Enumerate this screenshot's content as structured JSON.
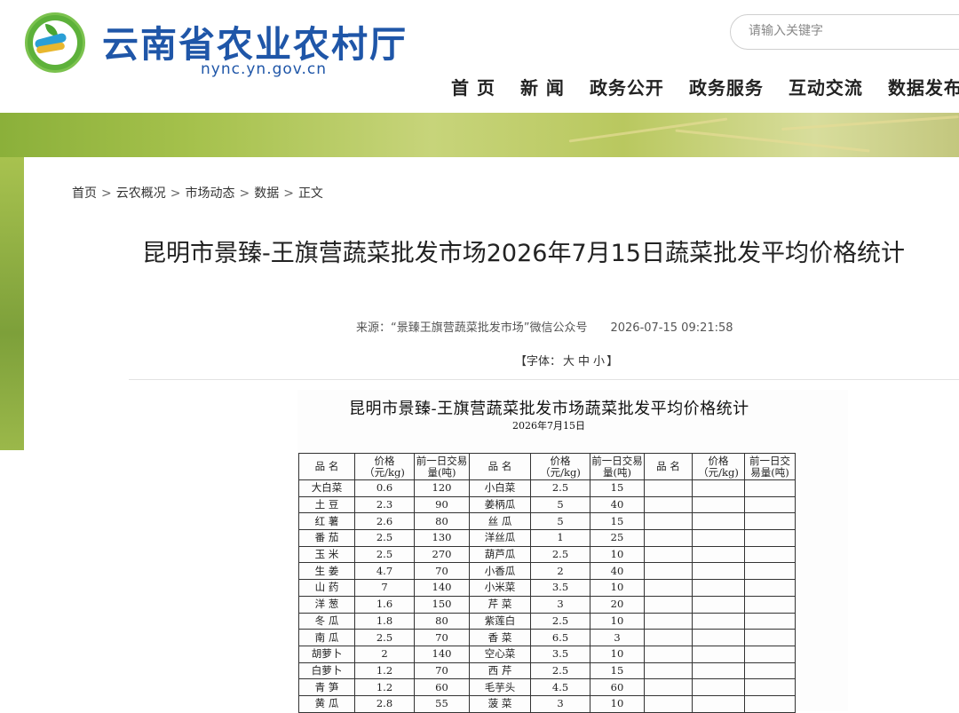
{
  "header": {
    "site_title": "云南省农业农村厅",
    "site_domain": "nync.yn.gov.cn",
    "search_placeholder": "请输入关键字"
  },
  "nav": [
    "首 页",
    "新 闻",
    "政务公开",
    "政务服务",
    "互动交流",
    "数据发布"
  ],
  "breadcrumb": [
    "首页",
    "云农概况",
    "市场动态",
    "数据",
    "正文"
  ],
  "breadcrumb_separator": ">",
  "article": {
    "title": "昆明市景臻-王旗营蔬菜批发市场2026年7月15日蔬菜批发平均价格统计",
    "source": "来源：“景臻王旗营蔬菜批发市场”微信公众号",
    "date": "2026-07-15 09:21:58",
    "font_prefix": "【字体：",
    "font_large": "大",
    "font_medium": "中",
    "font_small": "小",
    "font_suffix": "】"
  },
  "table": {
    "title": "昆明市景臻-王旗营蔬菜批发市场蔬菜批发平均价格统计",
    "date": "2026年7月15日",
    "headers": [
      "品  名",
      "价格（元/kg)",
      "前一日交易量(吨)",
      "品  名",
      "价格（元/kg)",
      "前一日交易量(吨)",
      "品  名",
      "价格（元/kg)",
      "前一日交易量(吨)"
    ],
    "rows": [
      [
        "大白菜",
        "0.6",
        "120",
        "小白菜",
        "2.5",
        "15",
        "",
        "",
        ""
      ],
      [
        "土  豆",
        "2.3",
        "90",
        "姜柄瓜",
        "5",
        "40",
        "",
        "",
        ""
      ],
      [
        "红  薯",
        "2.6",
        "80",
        "丝  瓜",
        "5",
        "15",
        "",
        "",
        ""
      ],
      [
        "番  茄",
        "2.5",
        "130",
        "洋丝瓜",
        "1",
        "25",
        "",
        "",
        ""
      ],
      [
        "玉  米",
        "2.5",
        "270",
        "葫芦瓜",
        "2.5",
        "10",
        "",
        "",
        ""
      ],
      [
        "生  姜",
        "4.7",
        "70",
        "小香瓜",
        "2",
        "40",
        "",
        "",
        ""
      ],
      [
        "山  药",
        "7",
        "140",
        "小米菜",
        "3.5",
        "10",
        "",
        "",
        ""
      ],
      [
        "洋  葱",
        "1.6",
        "150",
        "芹  菜",
        "3",
        "20",
        "",
        "",
        ""
      ],
      [
        "冬  瓜",
        "1.8",
        "80",
        "紫莲白",
        "2.5",
        "10",
        "",
        "",
        ""
      ],
      [
        "南  瓜",
        "2.5",
        "70",
        "香  菜",
        "6.5",
        "3",
        "",
        "",
        ""
      ],
      [
        "胡萝卜",
        "2",
        "140",
        "空心菜",
        "3.5",
        "10",
        "",
        "",
        ""
      ],
      [
        "白萝卜",
        "1.2",
        "70",
        "西  芹",
        "2.5",
        "15",
        "",
        "",
        ""
      ],
      [
        "青  笋",
        "1.2",
        "60",
        "毛芋头",
        "4.5",
        "60",
        "",
        "",
        ""
      ],
      [
        "黄  瓜",
        "2.8",
        "55",
        "菠  菜",
        "3",
        "10",
        "",
        "",
        ""
      ]
    ]
  }
}
